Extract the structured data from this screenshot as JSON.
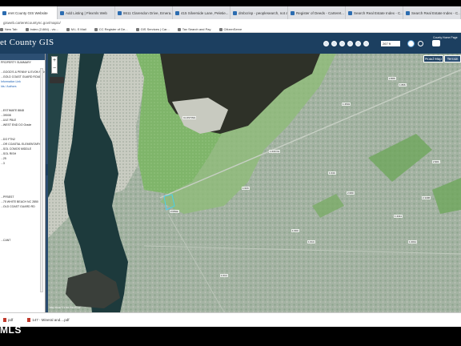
{
  "browser": {
    "tabs": [
      {
        "label": "eret County GIS Website"
      },
      {
        "label": "Add Listing | Flexmls Web"
      },
      {
        "label": "8611 Clarendon Drive, Emera..."
      },
      {
        "label": "415 Silverside Lane, Peletie..."
      },
      {
        "label": "dmbcrisp - peoplesearch, not au..."
      },
      {
        "label": "Register of Deeds - Carteret..."
      },
      {
        "label": "Search Real Estate Index - C..."
      },
      {
        "label": "Search Real Estate Index - C..."
      }
    ],
    "url": "gisweb.carteretcountync.gov/mapio/",
    "bookmarks": [
      "New Tab",
      "Index (2,684) - vic...",
      "M.L.S Mail",
      "CC Register of De...",
      "GIS Services | Car...",
      "Tax Search and Pay",
      "CitizenServe"
    ]
  },
  "gis": {
    "title": "et County GIS",
    "scale": "267 ft",
    "county_label": "County Home Page",
    "basemap_road": "Road Map",
    "basemap_terrain": "Terrain",
    "attribution": "Map Scale  © 1:00 / Dist Feet"
  },
  "panel": {
    "rows": [
      {
        "text": "PROPERTY SUMMARY",
        "link": false
      },
      {
        "text": "",
        "link": false
      },
      {
        "text": "...GOOD'S & PENNY & EVON MANSON",
        "link": false
      },
      {
        "text": "...GOLD COAST GUARD ROAD",
        "link": false
      },
      {
        "text": "Information Link",
        "link": true
      },
      {
        "text": "Ids / Authors",
        "link": true
      },
      {
        "text": "",
        "link": false
      },
      {
        "text": "",
        "link": false
      },
      {
        "text": "",
        "link": false
      },
      {
        "text": "",
        "link": false
      },
      {
        "text": "...ESTIMATE 8848",
        "link": false
      },
      {
        "text": "...39008",
        "link": false
      },
      {
        "text": "...ULE P8LE",
        "link": false
      },
      {
        "text": "...WEST END DO Grade",
        "link": false
      },
      {
        "text": "",
        "link": false
      },
      {
        "text": "",
        "link": false
      },
      {
        "text": "...DO FTN2",
        "link": false
      },
      {
        "text": "...OR COASTAL ELEMENTARY",
        "link": false
      },
      {
        "text": "...SOL COMOS MIDDLE",
        "link": false
      },
      {
        "text": "...SOL RISH",
        "link": false
      },
      {
        "text": "...25",
        "link": false
      },
      {
        "text": "...3",
        "link": false
      },
      {
        "text": "",
        "link": false
      },
      {
        "text": "",
        "link": false
      },
      {
        "text": "",
        "link": false
      },
      {
        "text": "",
        "link": false
      },
      {
        "text": "",
        "link": false
      },
      {
        "text": "",
        "link": false
      },
      {
        "text": "...PFBEST",
        "link": false
      },
      {
        "text": "...75 WHITE BEACH NC 2850",
        "link": false
      },
      {
        "text": "...OLD COAST GUARD RD",
        "link": false
      },
      {
        "text": "",
        "link": false
      },
      {
        "text": "",
        "link": false
      },
      {
        "text": "",
        "link": false
      },
      {
        "text": "",
        "link": false
      },
      {
        "text": "",
        "link": false
      },
      {
        "text": "",
        "link": false
      },
      {
        "text": "...CANT",
        "link": false
      }
    ]
  },
  "map_labels": [
    {
      "text": "CLOSTING"
    },
    {
      "text": "2 MILE"
    },
    {
      "text": "1 4501"
    },
    {
      "text": "1 866"
    },
    {
      "text": "2 806"
    },
    {
      "text": "1 044 Ce"
    },
    {
      "text": "1 024"
    },
    {
      "text": "2 080"
    },
    {
      "text": "1 044"
    },
    {
      "text": "1 014"
    },
    {
      "text": "1 014"
    },
    {
      "text": "1 4411"
    },
    {
      "text": "1 2011"
    },
    {
      "text": "1 004"
    },
    {
      "text": "2 1406"
    },
    {
      "text": "2 901"
    }
  ],
  "downloads": [
    {
      "label": "pdf"
    },
    {
      "label": "147 - Mineral and....pdf"
    }
  ],
  "watermark": "MLS",
  "colors": {
    "header": "#1c3f60",
    "water_dark": "#2a2e27",
    "water_channel": "#1d3b3f",
    "marsh": "#7fb26b",
    "urban": "#9fb0a0"
  }
}
